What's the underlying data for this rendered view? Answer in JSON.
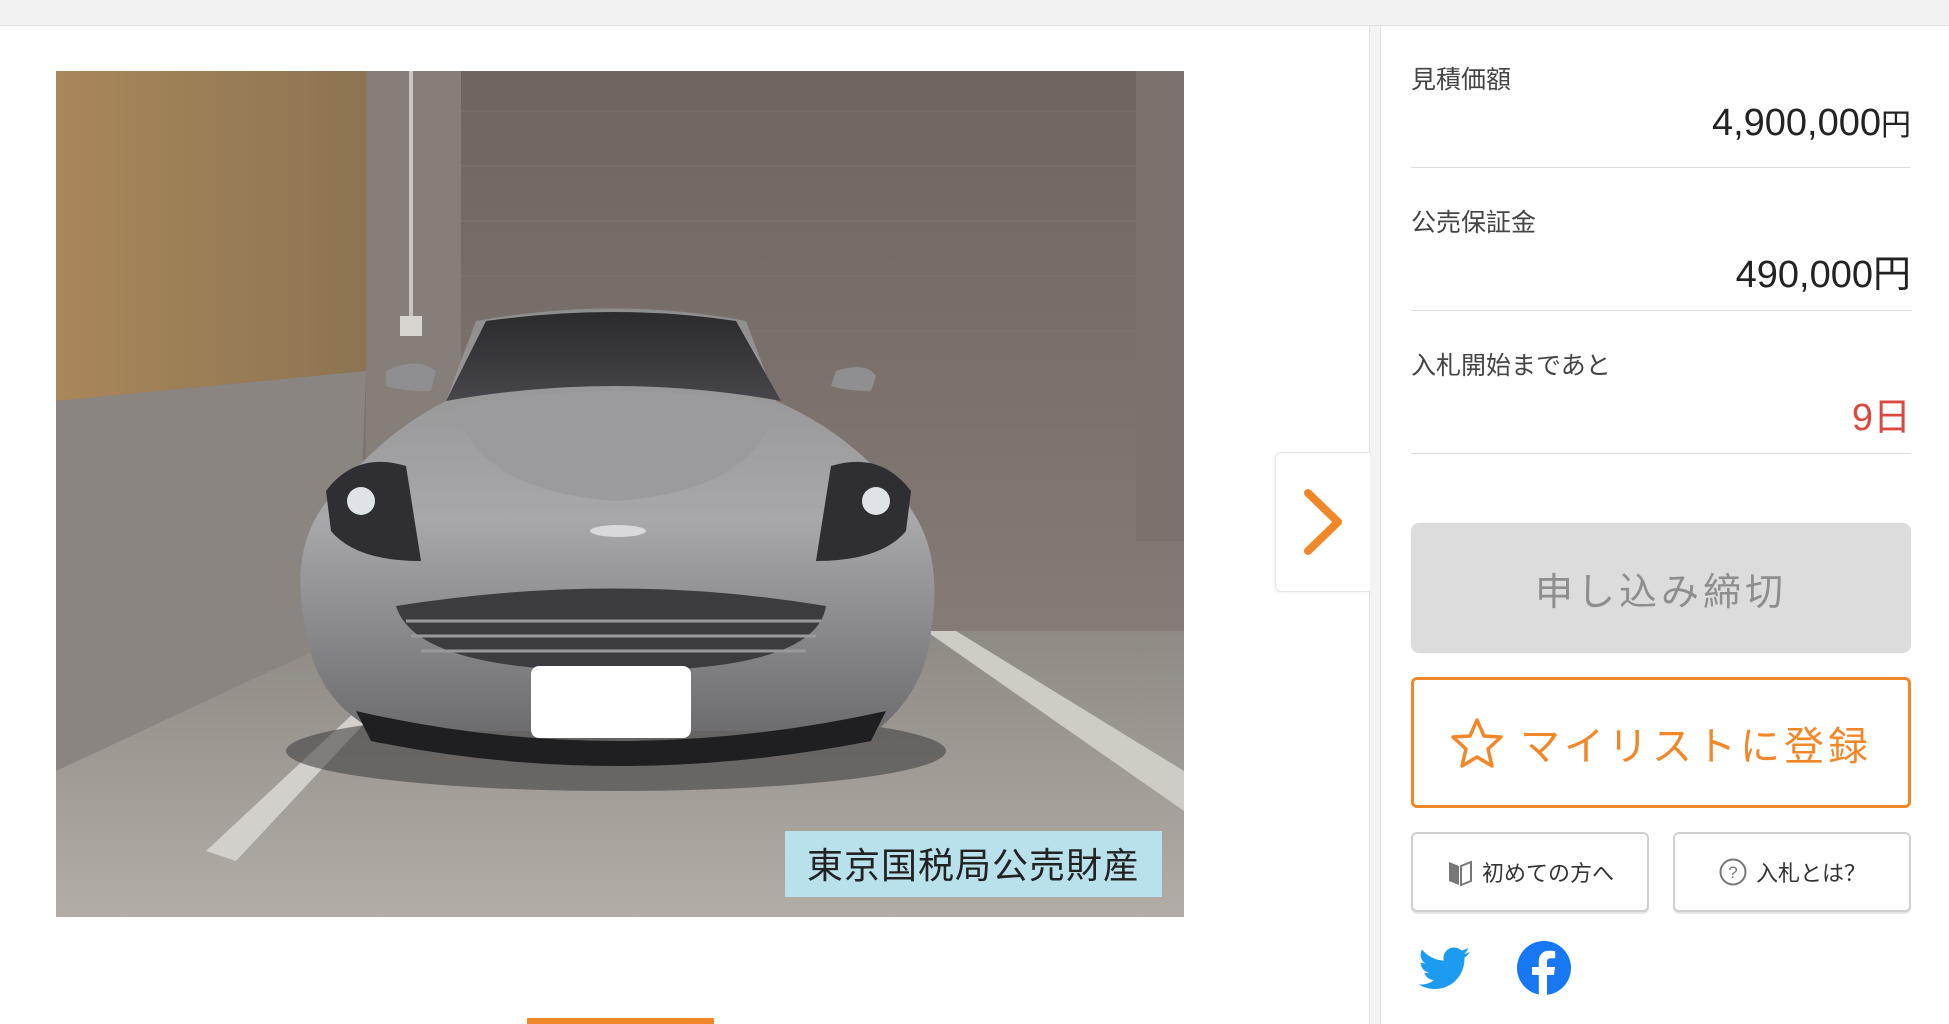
{
  "photo": {
    "caption": "東京国税局公売財産"
  },
  "info": {
    "estimate_label": "見積価額",
    "estimate_value": "4,900,000",
    "estimate_unit": "円",
    "deposit_label": "公売保証金",
    "deposit_value": "490,000",
    "deposit_unit": "円",
    "countdown_label": "入札開始まであと",
    "countdown_value": "9日"
  },
  "buttons": {
    "closed_label": "申し込み締切",
    "mylist_label": "マイリストに登録",
    "beginner_label": "初めての方へ",
    "bidding_label": "入札とは？"
  },
  "colors": {
    "accent": "#f0882a",
    "countdown": "#d84a3f",
    "twitter": "#1d9bf0",
    "facebook": "#1877f2"
  },
  "icons": {
    "next": "chevron-right-icon",
    "mylist": "star-outline-icon",
    "beginner": "book-icon",
    "help": "question-circle-icon",
    "twitter": "twitter-icon",
    "facebook": "facebook-icon"
  }
}
